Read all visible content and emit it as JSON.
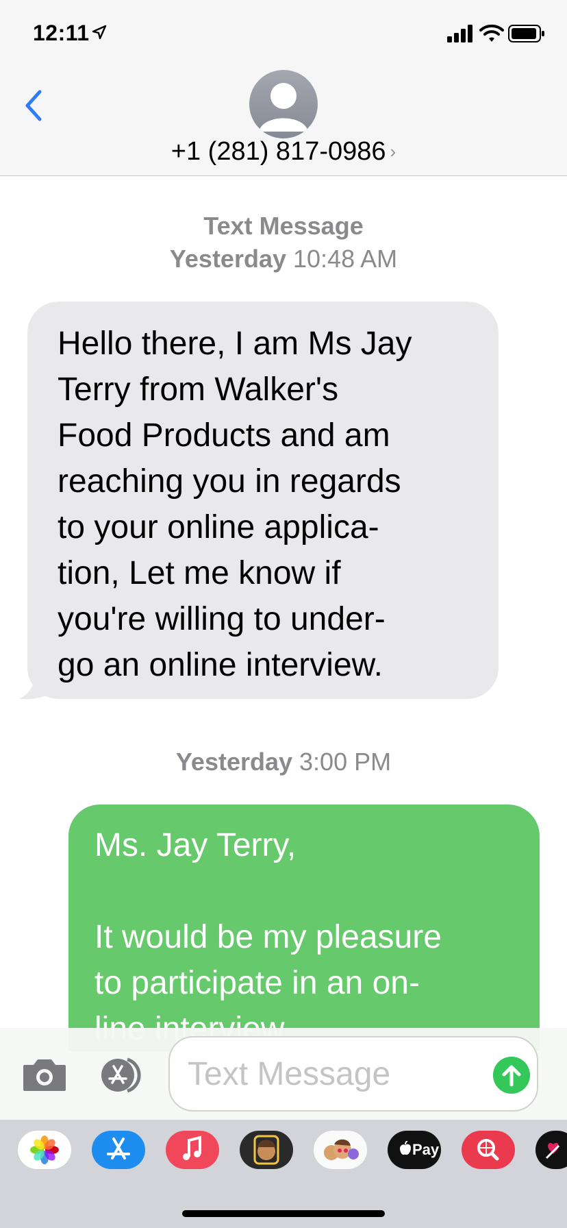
{
  "status_bar": {
    "time": "12:11",
    "icons": [
      "location-arrow-icon",
      "signal-icon",
      "wifi-icon",
      "battery-icon"
    ]
  },
  "header": {
    "back_icon": "chevron-left-icon",
    "contact": "+1 (281) 817-0986",
    "chevron": "›",
    "accent_color": "#2f7cf6"
  },
  "conversation": {
    "first_timestamp": {
      "label": "Text Message",
      "day": "Yesterday",
      "time": "10:48 AM"
    },
    "incoming": {
      "lines": [
        "Hello there, I am Ms Jay",
        "Terry from Walker's",
        "Food Products and am",
        "reaching you in regards",
        "to your online applica-",
        "tion, Let me know if",
        "you're willing to under-",
        "go an online interview."
      ],
      "color": "#e9e9eb"
    },
    "second_timestamp": {
      "day": "Yesterday",
      "time": "3:00 PM"
    },
    "outgoing": {
      "lines": [
        "Ms. Jay Terry,",
        "",
        "It would be my pleasure",
        "to participate in an on-",
        "line interview."
      ],
      "color": "#66c96b"
    }
  },
  "compose": {
    "placeholder": "Text Message",
    "icons": [
      "camera-icon",
      "app-store-icon",
      "send-arrow-icon"
    ]
  },
  "app_drawer": {
    "apps": [
      "photos-icon",
      "app-store-icon",
      "music-icon",
      "memoji-icon",
      "memoji-stickers-icon",
      "apple-pay-icon",
      "image-search-icon",
      "more-app-icon"
    ],
    "apple_pay_label": "Pay"
  }
}
